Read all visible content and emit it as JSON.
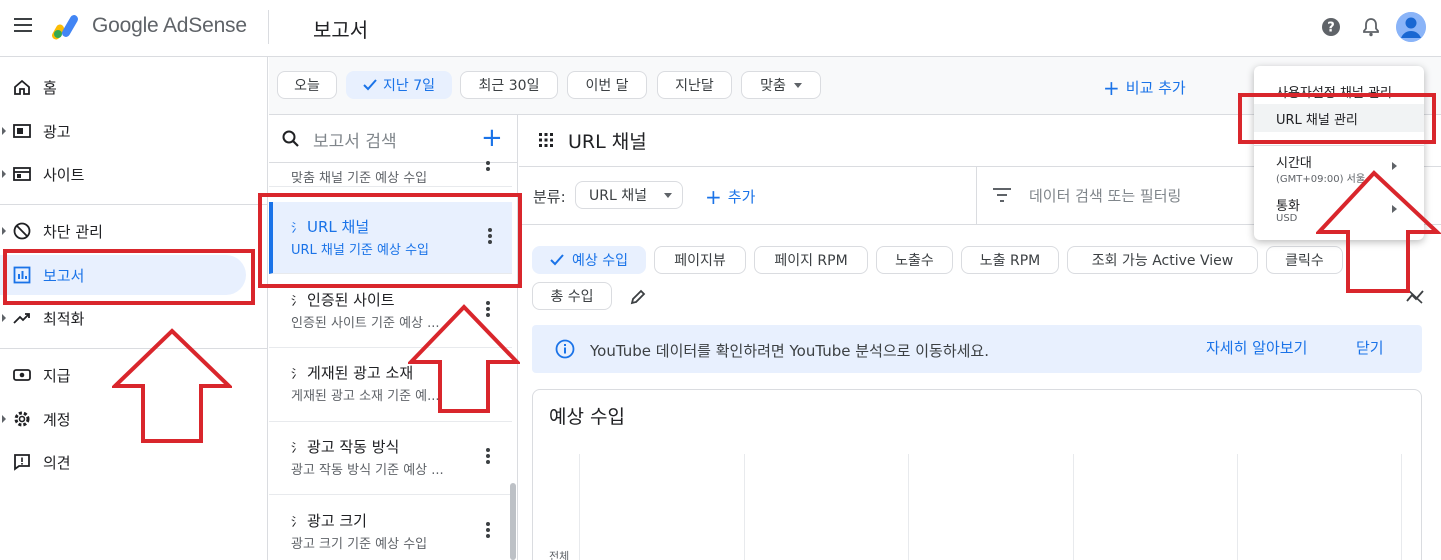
{
  "app": {
    "brand": "Google AdSense",
    "page_title": "보고서"
  },
  "sidebar": {
    "items": [
      {
        "label": "홈",
        "icon": "home-icon"
      },
      {
        "label": "광고",
        "icon": "ads-icon"
      },
      {
        "label": "사이트",
        "icon": "sites-icon"
      },
      {
        "label": "차단 관리",
        "icon": "block-icon"
      },
      {
        "label": "보고서",
        "icon": "reports-icon",
        "active": true
      },
      {
        "label": "최적화",
        "icon": "optimize-icon"
      },
      {
        "label": "지급",
        "icon": "payments-icon"
      },
      {
        "label": "계정",
        "icon": "settings-icon"
      },
      {
        "label": "의견",
        "icon": "feedback-icon"
      }
    ]
  },
  "date_range": {
    "chips": [
      {
        "label": "오늘"
      },
      {
        "label": "지난 7일",
        "selected": true
      },
      {
        "label": "최근 30일"
      },
      {
        "label": "이번 달"
      },
      {
        "label": "지난달"
      },
      {
        "label": "맞춤"
      }
    ],
    "add_compare": "비교 추가"
  },
  "reports": {
    "search_placeholder": "보고서 검색",
    "partial_top_sub": "맞춤 채널 기준 예상 수입",
    "items": [
      {
        "title": "URL 채널",
        "sub": "URL 채널 기준 예상 수입",
        "active": true
      },
      {
        "title": "인증된 사이트",
        "sub": "인증된 사이트 기준 예상 ..."
      },
      {
        "title": "게재된 광고 소재",
        "sub": "게재된 광고 소재 기준 예..."
      },
      {
        "title": "광고 작동 방식",
        "sub": "광고 작동 방식 기준 예상 ..."
      },
      {
        "title": "광고 크기",
        "sub": "광고 크기 기준 예상 수입"
      }
    ]
  },
  "main": {
    "title": "URL 채널",
    "dimension_label": "분류:",
    "dimension_value": "URL 채널",
    "add_dimension": "추가",
    "filter_placeholder": "데이터 검색 또는 필터링",
    "metrics": [
      "예상 수입",
      "페이지뷰",
      "페이지 RPM",
      "노출수",
      "노출 RPM",
      "조회 가능 Active View",
      "클릭수",
      "총 수입"
    ],
    "banner_text": "YouTube 데이터를 확인하려면 YouTube 분석으로 이동하세요.",
    "banner_learn": "자세히 알아보기",
    "banner_close": "닫기",
    "chart_title": "예상 수입",
    "chart_axis_label": "전체"
  },
  "menu": {
    "items": [
      {
        "label": "사용자설정 채널 관리"
      },
      {
        "label": "URL 채널 관리",
        "highlighted": true
      },
      {
        "label": "시간대",
        "sub": "(GMT+09:00) 서울"
      },
      {
        "label": "통화",
        "sub": "USD"
      }
    ]
  },
  "colors": {
    "accent": "#1a73e8",
    "annotation_red": "#d9262c"
  }
}
